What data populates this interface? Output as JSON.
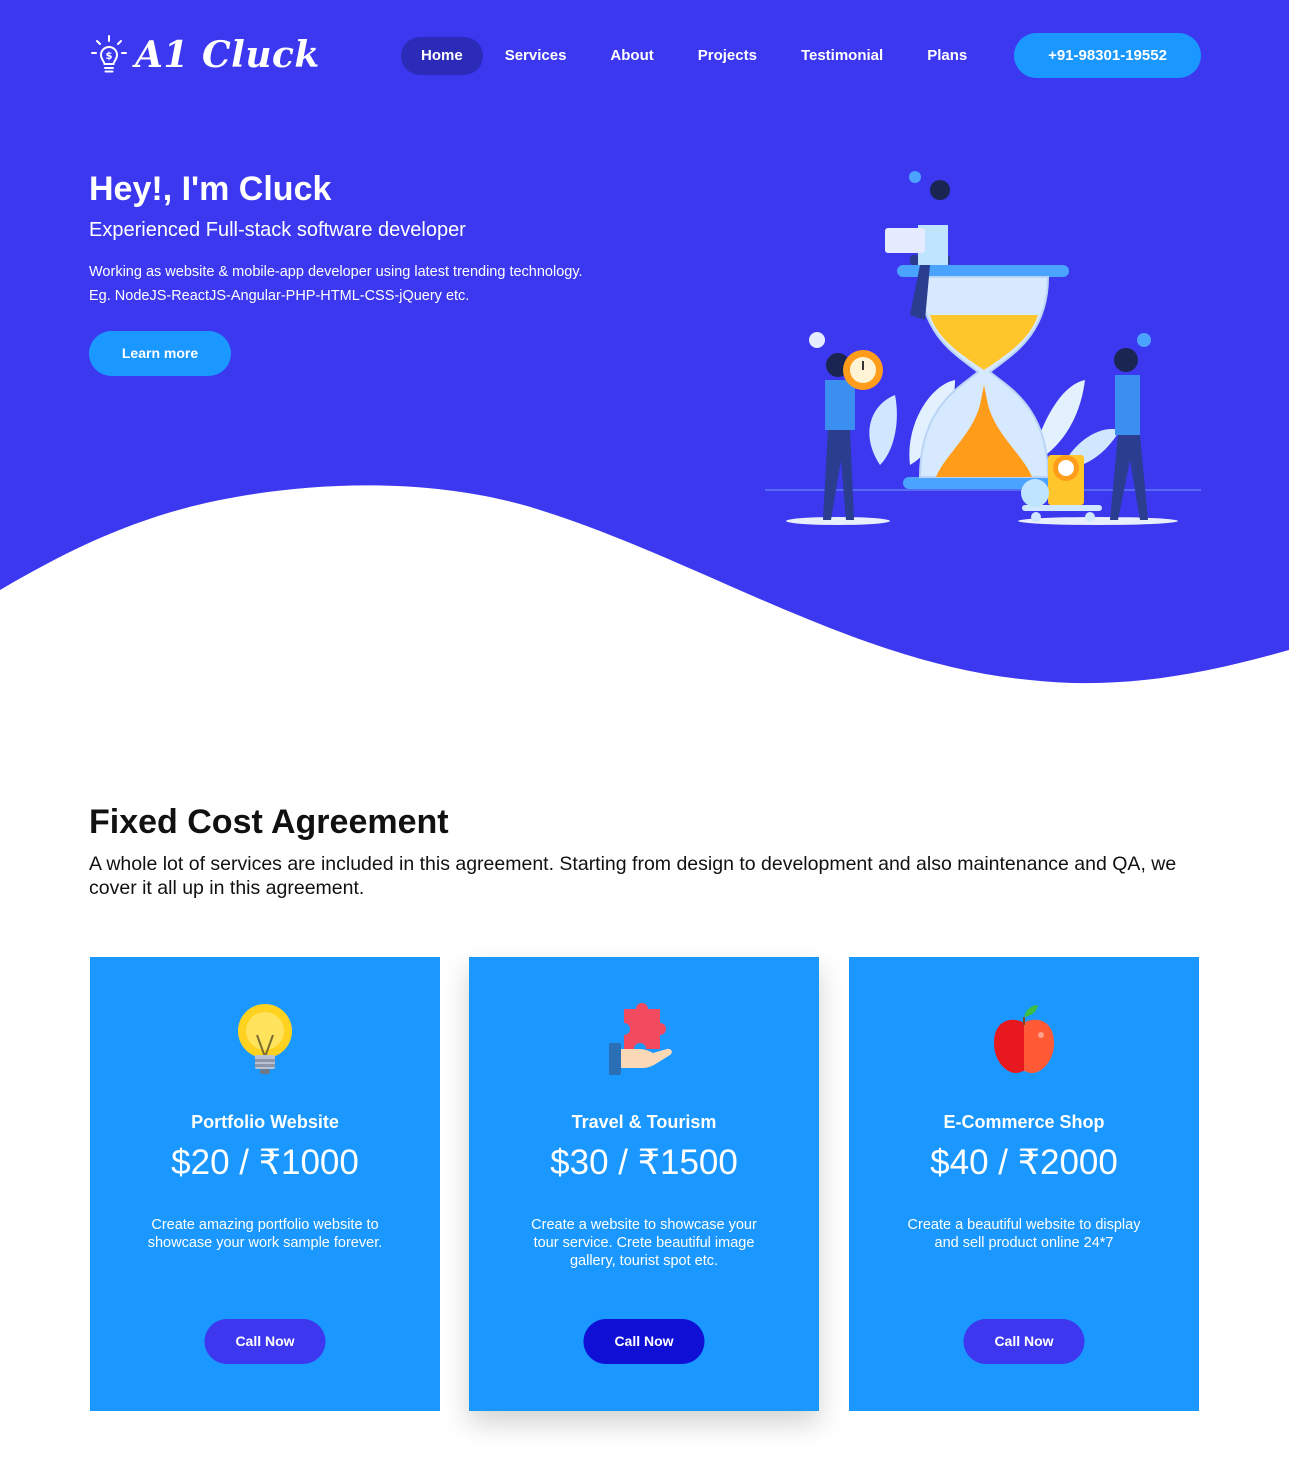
{
  "colors": {
    "primary": "#3c38f0",
    "accent": "#1a98ff",
    "nav_active": "#2b2bb8",
    "text_dark": "#111111"
  },
  "header": {
    "logo_text": "A1 Cluck",
    "logo_icon": "lightbulb-dollar-icon",
    "nav": [
      {
        "label": "Home",
        "active": true
      },
      {
        "label": "Services"
      },
      {
        "label": "About"
      },
      {
        "label": "Projects"
      },
      {
        "label": "Testimonial"
      },
      {
        "label": "Plans"
      }
    ],
    "phone": "+91-98301-19552"
  },
  "hero": {
    "title": "Hey!, I'm Cluck",
    "subtitle": "Experienced Full-stack software developer",
    "desc_line1": "Working as website & mobile-app developer using latest trending technology.",
    "desc_line2": "Eg. NodeJS-ReactJS-Angular-PHP-HTML-CSS-jQuery etc.",
    "cta": "Learn more",
    "illustration": "hourglass-team-illustration"
  },
  "plans": {
    "title": "Fixed Cost Agreement",
    "description": "A whole lot of services are included in this agreement. Starting from design to development and also maintenance and QA, we cover it all up in this agreement.",
    "cards": [
      {
        "icon": "lightbulb-icon",
        "title": "Portfolio Website",
        "price": "$20 / ₹1000",
        "description": "Create amazing portfolio website to showcase your work sample forever.",
        "cta": "Call Now"
      },
      {
        "icon": "puzzle-hand-icon",
        "title": "Travel & Tourism",
        "price": "$30 / ₹1500",
        "description": "Create a website to showcase your tour service. Crete beautiful image gallery, tourist spot etc.",
        "cta": "Call Now"
      },
      {
        "icon": "apple-icon",
        "title": "E-Commerce Shop",
        "price": "$40 / ₹2000",
        "description": "Create a beautiful website to display and sell product online 24*7",
        "cta": "Call Now"
      }
    ]
  }
}
